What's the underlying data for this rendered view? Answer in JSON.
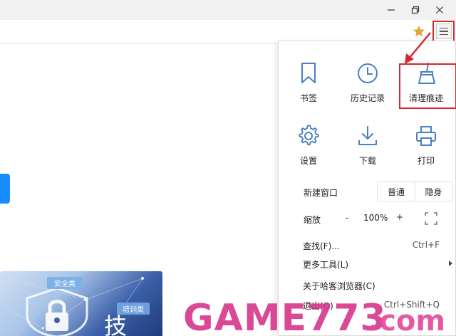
{
  "window": {
    "minimize_icon": "minimize-icon",
    "restore_icon": "restore-icon",
    "close_icon": "close-icon"
  },
  "toolbar": {
    "star_color": "#e8a33c",
    "menu_icon": "hamburger-menu-icon",
    "highlight_color": "#d7282f"
  },
  "banner": {
    "tag1": "安全类",
    "tag2": "培训类",
    "big_text": "技"
  },
  "menu": {
    "tiles": [
      {
        "label": "书签",
        "icon": "bookmark-icon"
      },
      {
        "label": "历史记录",
        "icon": "history-clock-icon"
      },
      {
        "label": "清理痕迹",
        "icon": "broom-icon"
      },
      {
        "label": "设置",
        "icon": "gear-icon"
      },
      {
        "label": "下载",
        "icon": "download-icon"
      },
      {
        "label": "打印",
        "icon": "printer-icon"
      }
    ],
    "new_window": {
      "label": "新建窗口",
      "normal": "普通",
      "private": "隐身"
    },
    "zoom": {
      "label": "缩放",
      "minus": "-",
      "value": "100%",
      "plus": "+",
      "fullscreen_icon": "fullscreen-icon"
    },
    "items": [
      {
        "label": "查找(F)...",
        "shortcut": "Ctrl+F"
      },
      {
        "label": "更多工具(L)",
        "shortcut": ""
      },
      {
        "label": "关于哈客浏览器(C)",
        "shortcut": ""
      },
      {
        "label": "退出(Q)",
        "shortcut": "Ctrl+Shift+Q"
      }
    ],
    "accent_color": "#4a7fc1"
  },
  "watermark": {
    "text": "GAME773.com",
    "color": "#d63a8e"
  }
}
